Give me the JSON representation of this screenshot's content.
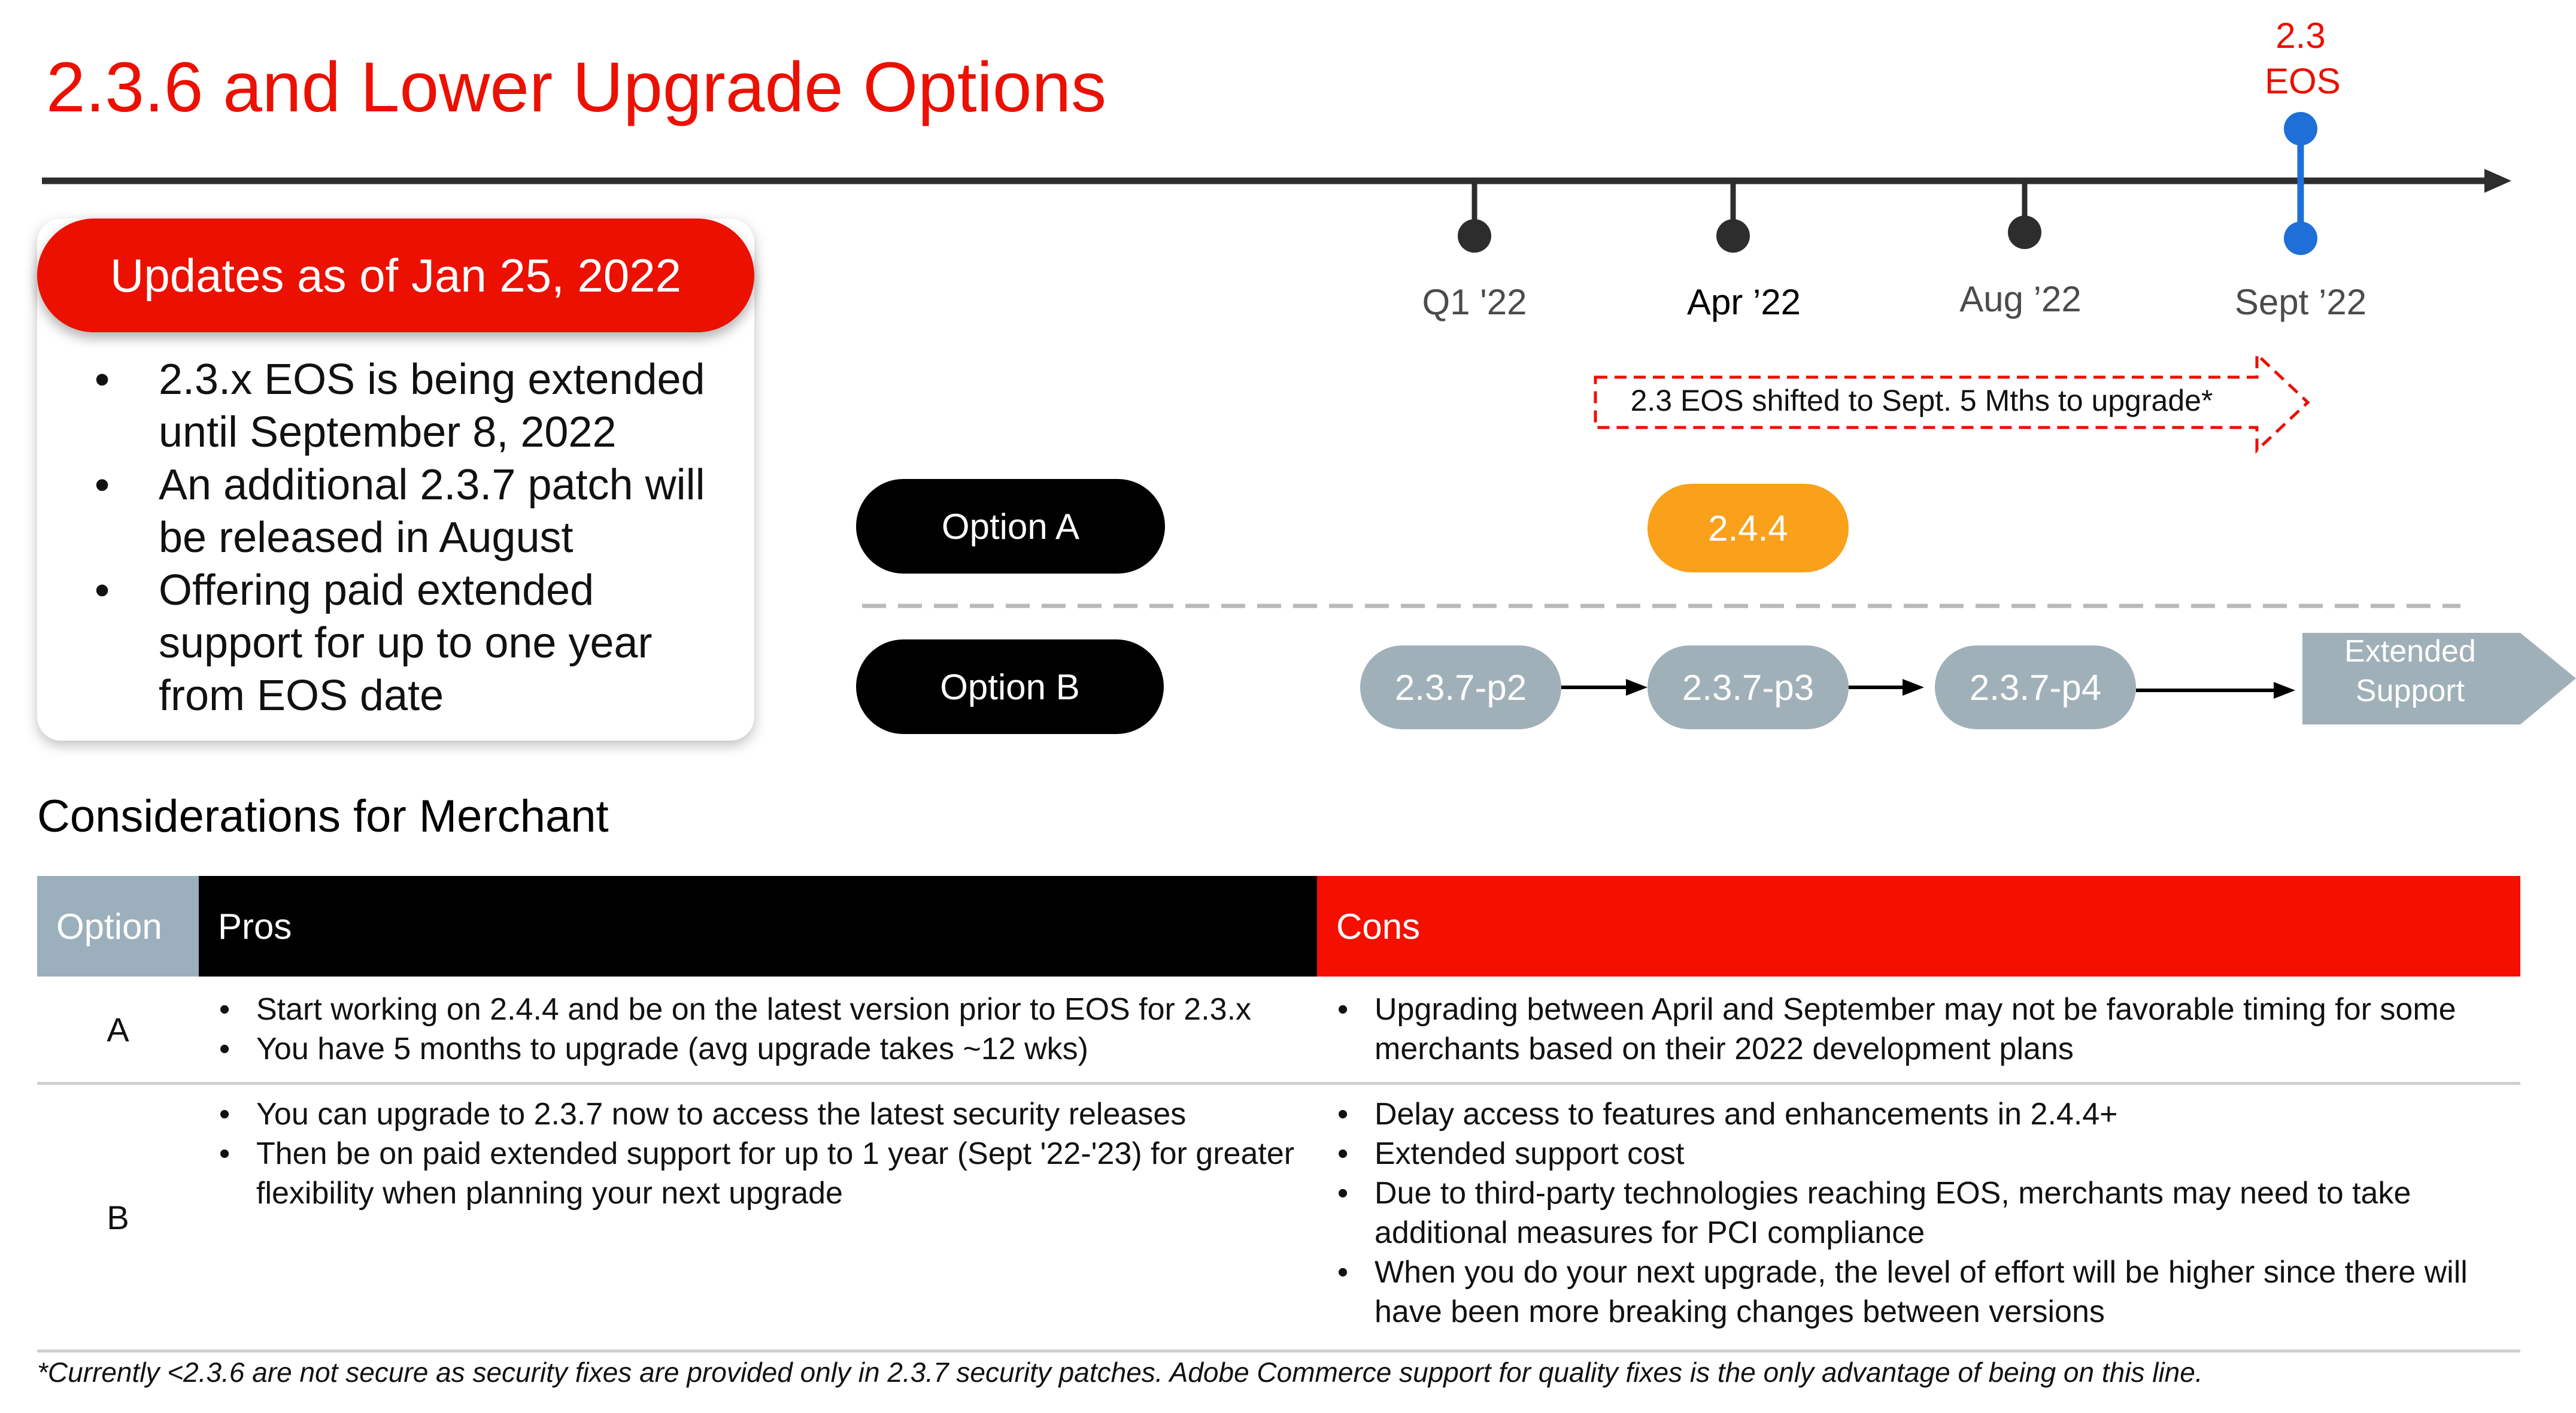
{
  "title": "2.3.6 and Lower Upgrade Options",
  "timeline": {
    "eos_marker": {
      "line1": "2.3",
      "line2": "EOS"
    },
    "milestones": [
      "Q1 '22",
      "Apr ’22",
      "Aug ’22",
      "Sept ’22"
    ],
    "shift_note": "2.3 EOS shifted to Sept. 5 Mths to upgrade*"
  },
  "updates": {
    "header": "Updates as of Jan 25, 2022",
    "items": [
      "2.3.x EOS is being extended until September 8, 2022",
      "An additional 2.3.7 patch will be released in August",
      "Offering paid extended support for up to one year from EOS date"
    ]
  },
  "options": {
    "a": {
      "label": "Option A",
      "steps": [
        "2.4.4"
      ]
    },
    "b": {
      "label": "Option B",
      "steps": [
        "2.3.7-p2",
        "2.3.7-p3",
        "2.3.7-p4"
      ],
      "end_line1": "Extended",
      "end_line2": "Support"
    }
  },
  "considerations": {
    "title": "Considerations for Merchant",
    "headers": {
      "option": "Option",
      "pros": "Pros",
      "cons": "Cons"
    },
    "rows": [
      {
        "option": "A",
        "pros": [
          "Start working on 2.4.4 and be on the latest version prior to EOS for 2.3.x",
          "You have 5 months to upgrade (avg upgrade takes ~12 wks)"
        ],
        "cons": [
          "Upgrading between April and September may not be favorable timing for some merchants based on their 2022 development plans"
        ]
      },
      {
        "option": "B",
        "pros": [
          "You can upgrade to 2.3.7 now to access the latest security releases",
          "Then be on paid extended support for up to 1 year (Sept '22-'23) for greater flexibility when planning your next upgrade"
        ],
        "cons": [
          "Delay access to features and enhancements in 2.4.4+",
          "Extended support cost",
          "Due to third-party technologies reaching EOS, merchants may need to take additional measures for PCI compliance",
          "When you do your next upgrade, the level of effort will be higher since there will have been more breaking changes between versions"
        ]
      }
    ]
  },
  "footnote": "*Currently <2.3.6 are not secure as security fixes are provided only in 2.3.7 security patches. Adobe Commerce support for quality fixes is the only advantage of being on this line.",
  "colors": {
    "brand_red": "#eb1000",
    "option_a_orange": "#f9a11b",
    "option_b_grey": "#a0b0b8",
    "eos_blue": "#1f6fd8"
  }
}
